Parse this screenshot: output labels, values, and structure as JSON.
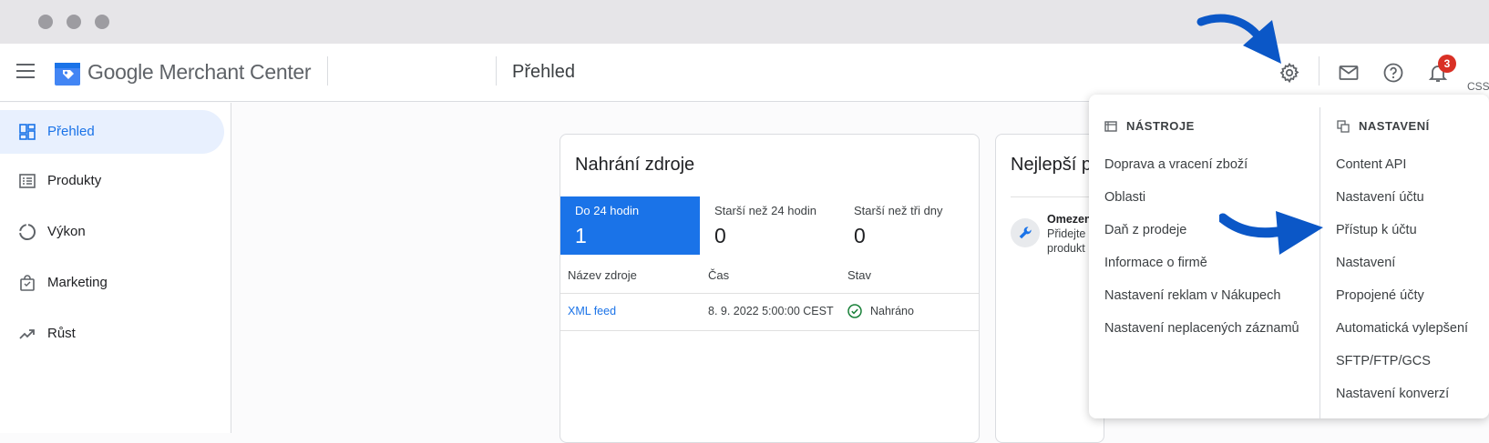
{
  "app": {
    "brand_primary": "Google",
    "brand_secondary": "Merchant Center",
    "page_title": "Přehled",
    "notification_count": "3",
    "account_label": "CSS:"
  },
  "sidebar": {
    "items": [
      {
        "label": "Přehled",
        "icon": "dashboard-icon",
        "active": true
      },
      {
        "label": "Produkty",
        "icon": "list-icon",
        "active": false
      },
      {
        "label": "Výkon",
        "icon": "donut-chart-icon",
        "active": false
      },
      {
        "label": "Marketing",
        "icon": "shopping-bag-icon",
        "active": false
      },
      {
        "label": "Růst",
        "icon": "trending-up-icon",
        "active": false
      }
    ]
  },
  "feed_card": {
    "title": "Nahrání zdroje",
    "stats": [
      {
        "label": "Do 24 hodin",
        "value": "1"
      },
      {
        "label": "Starší než 24 hodin",
        "value": "0"
      },
      {
        "label": "Starší než tři dny",
        "value": "0"
      }
    ],
    "columns": [
      "Název zdroje",
      "Čas",
      "Stav"
    ],
    "rows": [
      {
        "name": "XML feed",
        "time": "8. 9. 2022 5:00:00 CEST",
        "status": "Nahráno"
      }
    ]
  },
  "best_card": {
    "title": "Nejlepší p",
    "item_title": "Omezen",
    "item_line1": "Přidejte",
    "item_line2": "produkt"
  },
  "settings_menu": {
    "tools_heading": "NÁSTROJE",
    "tools": [
      "Doprava a vracení zboží",
      "Oblasti",
      "Daň z prodeje",
      "Informace o firmě",
      "Nastavení reklam v Nákupech",
      "Nastavení neplacených záznamů"
    ],
    "settings_heading": "NASTAVENÍ",
    "settings": [
      "Content API",
      "Nastavení účtu",
      "Přístup k účtu",
      "Nastavení",
      "Propojené účty",
      "Automatická vylepšení",
      "SFTP/FTP/GCS",
      "Nastavení konverzí"
    ]
  },
  "colors": {
    "accent": "#1a73e8",
    "annotation_arrow": "#0b57c7",
    "badge": "#d93025",
    "success": "#188038"
  }
}
